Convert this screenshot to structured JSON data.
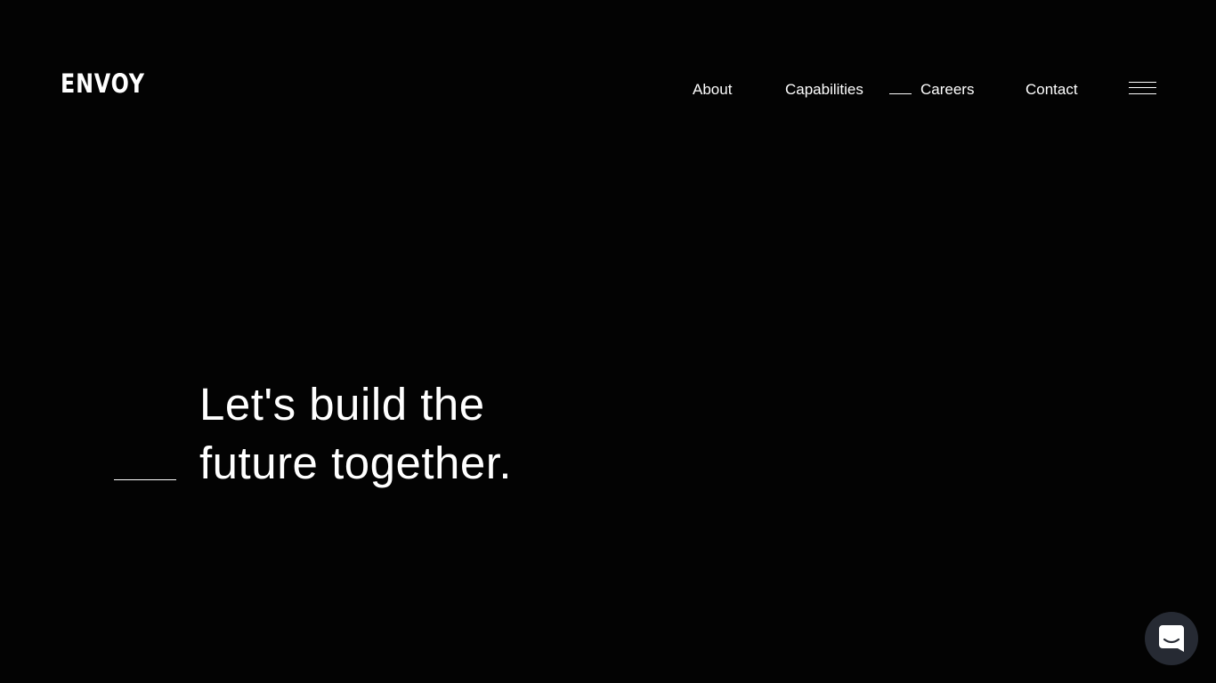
{
  "brand": {
    "logo_text": "ENVOY"
  },
  "nav": {
    "items": [
      {
        "label": "About"
      },
      {
        "label": "Capabilities"
      },
      {
        "label": "Careers"
      },
      {
        "label": "Contact"
      }
    ],
    "active_item": "Careers",
    "menu_icon": "hamburger-menu-icon"
  },
  "hero": {
    "line1": "Let's build the",
    "line2": "future together."
  },
  "chat": {
    "icon": "chat-icon"
  },
  "colors": {
    "background": "#030303",
    "text": "#ffffff",
    "chat_launcher": "#262a33"
  }
}
